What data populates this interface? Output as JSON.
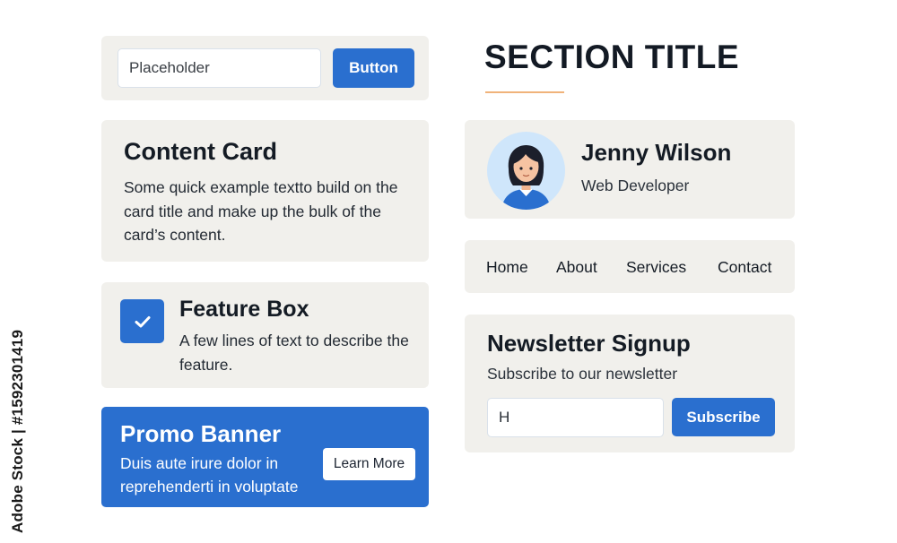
{
  "search": {
    "placeholder": "Placeholder",
    "button_label": "Button"
  },
  "content_card": {
    "title": "Content Card",
    "body": "Some quick example textto build on the card title and make up the bulk of the card’s content."
  },
  "feature_box": {
    "title": "Feature Box",
    "body": "A few lines of text to describe the feature.",
    "icon": "checkmark-icon"
  },
  "promo_banner": {
    "title": "Promo Banner",
    "body": "Duis aute irure dolor in reprehenderti in voluptate",
    "button_label": "Learn More"
  },
  "section": {
    "title": "SECTION TITLE"
  },
  "profile": {
    "name": "Jenny Wilson",
    "role": "Web Developer",
    "icon": "user-avatar"
  },
  "nav": {
    "items": [
      "Home",
      "About",
      "Services",
      "Contact"
    ]
  },
  "newsletter": {
    "title": "Newsletter Signup",
    "subtitle": "Subscribe to our newsletter",
    "input_value": "H",
    "button_label": "Subscribe"
  },
  "watermark": {
    "text": "Adobe Stock | #1592301419"
  },
  "colors": {
    "accent": "#2a6fcf",
    "panel": "#f1f0ec",
    "underline": "#f0b37a",
    "avatar_bg": "#cfe6fb"
  }
}
